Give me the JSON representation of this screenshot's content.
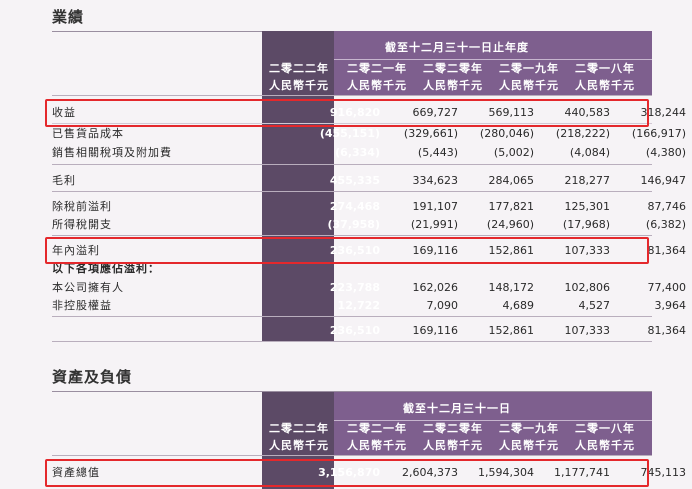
{
  "section1": {
    "title": "業績",
    "period_header": "截至十二月三十一日止年度",
    "years": [
      {
        "year": "二零二二年",
        "unit": "人民幣千元"
      },
      {
        "year": "二零二一年",
        "unit": "人民幣千元"
      },
      {
        "year": "二零二零年",
        "unit": "人民幣千元"
      },
      {
        "year": "二零一九年",
        "unit": "人民幣千元"
      },
      {
        "year": "二零一八年",
        "unit": "人民幣千元"
      }
    ],
    "rows": [
      {
        "label": "收益",
        "values": [
          "916,820",
          "669,727",
          "569,113",
          "440,583",
          "318,244"
        ]
      },
      {
        "label": "已售貨品成本",
        "values": [
          "(455,151)",
          "(329,661)",
          "(280,046)",
          "(218,222)",
          "(166,917)"
        ]
      },
      {
        "label": "銷售相關稅項及附加費",
        "values": [
          "(6,334)",
          "(5,443)",
          "(5,002)",
          "(4,084)",
          "(4,380)"
        ]
      },
      {
        "label": "毛利",
        "values": [
          "455,335",
          "334,623",
          "284,065",
          "218,277",
          "146,947"
        ]
      },
      {
        "label": "除稅前溢利",
        "values": [
          "274,468",
          "191,107",
          "177,821",
          "125,301",
          "87,746"
        ]
      },
      {
        "label": "所得稅開支",
        "values": [
          "(37,958)",
          "(21,991)",
          "(24,960)",
          "(17,968)",
          "(6,382)"
        ]
      },
      {
        "label": "年內溢利",
        "values": [
          "236,510",
          "169,116",
          "152,861",
          "107,333",
          "81,364"
        ]
      },
      {
        "label": "以下各項應佔溢利：",
        "values": [
          "",
          "",
          "",
          "",
          ""
        ]
      },
      {
        "label": "本公司擁有人",
        "values": [
          "223,788",
          "162,026",
          "148,172",
          "102,806",
          "77,400"
        ]
      },
      {
        "label": "非控股權益",
        "values": [
          "12,722",
          "7,090",
          "4,689",
          "4,527",
          "3,964"
        ]
      },
      {
        "label": "",
        "values": [
          "236,510",
          "169,116",
          "152,861",
          "107,333",
          "81,364"
        ]
      }
    ]
  },
  "section2": {
    "title": "資產及負債",
    "period_header": "截至十二月三十一日",
    "years": [
      {
        "year": "二零二二年",
        "unit": "人民幣千元"
      },
      {
        "year": "二零二一年",
        "unit": "人民幣千元"
      },
      {
        "year": "二零二零年",
        "unit": "人民幣千元"
      },
      {
        "year": "二零一九年",
        "unit": "人民幣千元"
      },
      {
        "year": "二零一八年",
        "unit": "人民幣千元"
      }
    ],
    "rows": [
      {
        "label": "資產總值",
        "values": [
          "3,156,870",
          "2,604,373",
          "1,594,304",
          "1,177,741",
          "745,113"
        ]
      }
    ]
  },
  "colors": {
    "header_band": "#7e5f8e",
    "highlight_col": "#5c4a66",
    "highlight_box": "#e4282c",
    "background": "#f6f3f6"
  }
}
